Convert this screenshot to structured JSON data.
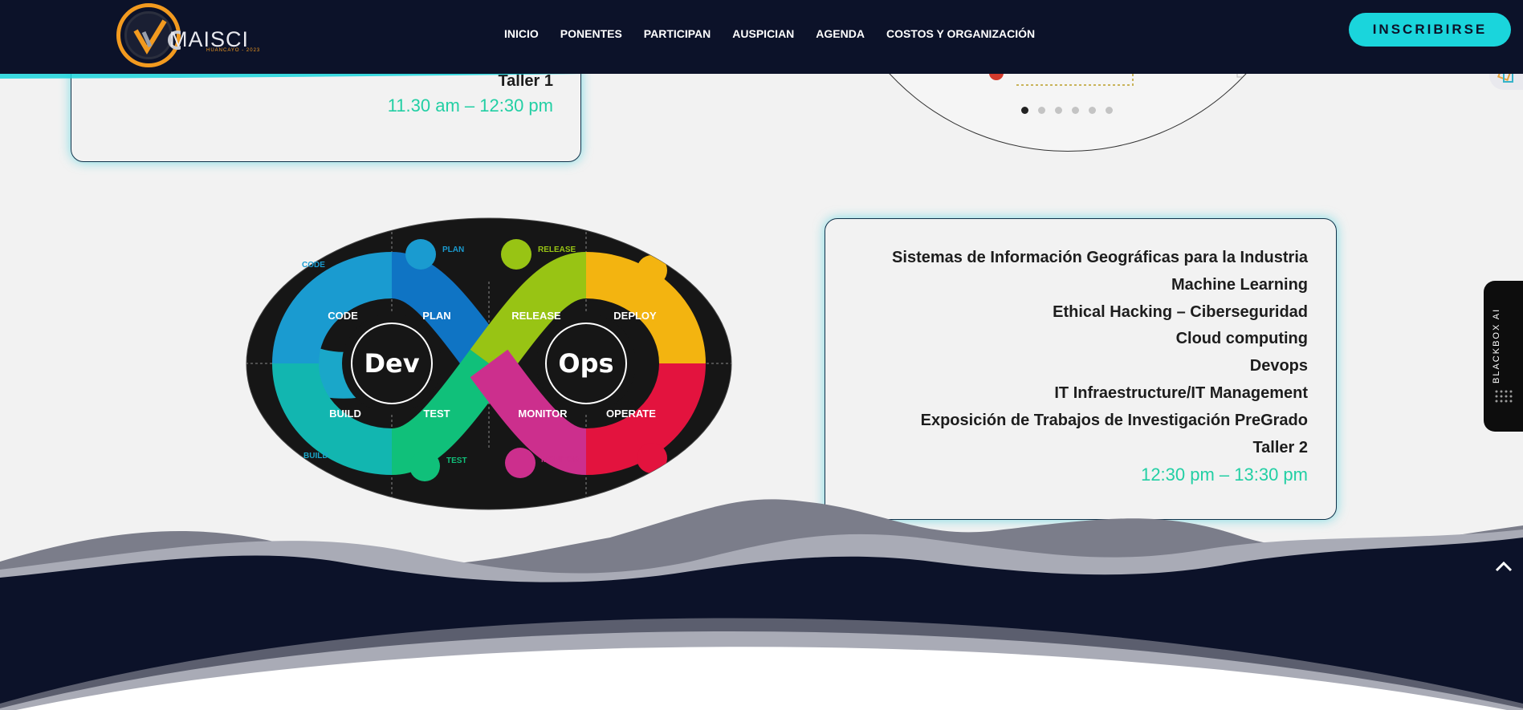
{
  "header": {
    "logo_text": "MAISCI",
    "logo_subtext": "HUANCAYO - 2023",
    "nav": [
      "INICIO",
      "PONENTES",
      "PARTICIPAN",
      "AUSPICIAN",
      "AGENDA",
      "COSTOS Y ORGANIZACIÓN"
    ],
    "cta_label": "INSCRIBIRSE"
  },
  "card_top": {
    "topic": "Taller 1",
    "time": "11.30 am – 12:30 pm"
  },
  "carousel": {
    "slide_count": 6,
    "active_index": 0
  },
  "devops_image": {
    "left_word": "Dev",
    "right_word": "Ops",
    "stages": [
      "CODE",
      "PLAN",
      "RELEASE",
      "DEPLOY",
      "BUILD",
      "TEST",
      "MONITOR",
      "OPERATE"
    ],
    "top_icons": [
      "CODE",
      "PLAN",
      "RELEASE"
    ],
    "bottom_icons": [
      "BUILD",
      "TEST",
      "MONITOR"
    ]
  },
  "card_bottom": {
    "topics": [
      "Sistemas de Información Geográficas para la Industria",
      "Machine Learning",
      "Ethical Hacking – Ciberseguridad",
      "Cloud computing",
      "Devops",
      "IT Infraestructure/IT Management",
      "Exposición de Trabajos de Investigación PreGrado",
      "Taller 2"
    ],
    "time": "12:30 pm – 13:30 pm"
  },
  "widgets": {
    "blackbox_label": "BLACKBOX AI"
  },
  "colors": {
    "navy": "#0c1229",
    "cyan": "#1ad5dc",
    "green_time": "#22cfa4",
    "orange_logo": "#f29a1f"
  }
}
